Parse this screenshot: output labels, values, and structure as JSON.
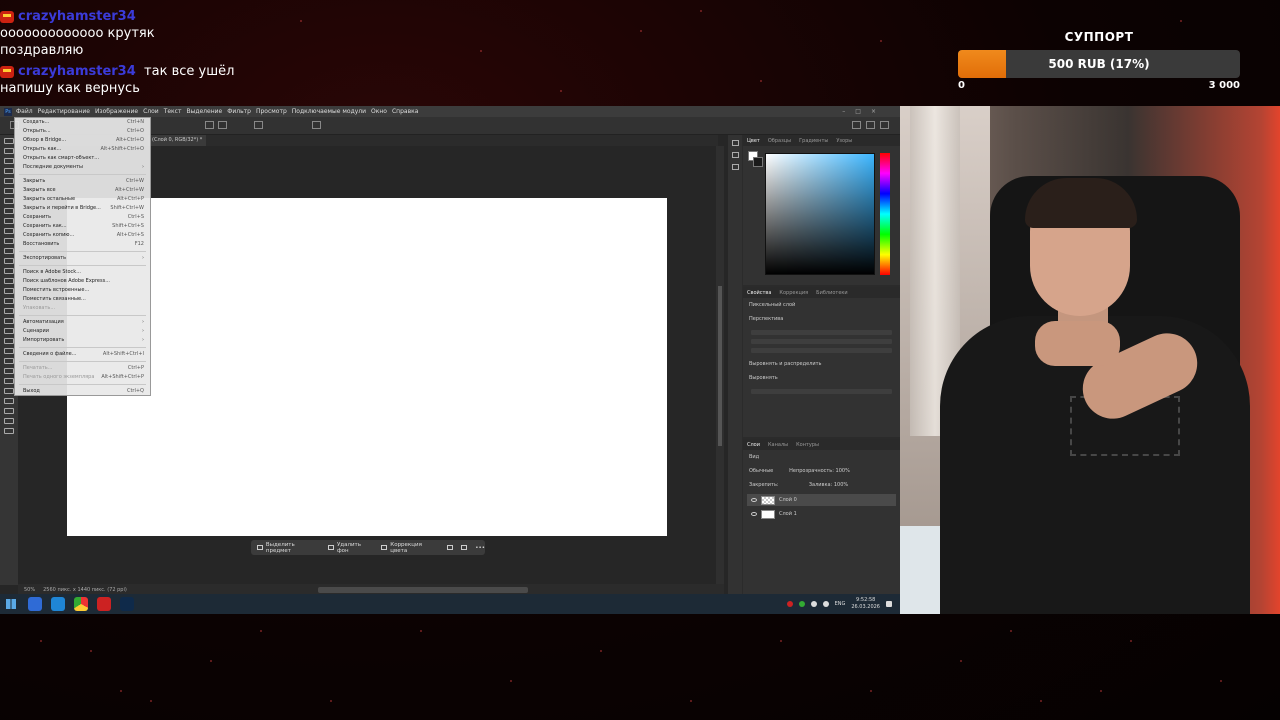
{
  "chat": {
    "messages": [
      {
        "user": "crazyhamster34",
        "text": "ооооооооооооо крутяк поздравляю"
      },
      {
        "user": "crazyhamster34",
        "text": "так все ушёл напишу как вернусь"
      }
    ]
  },
  "support": {
    "title": "СУППОРТ",
    "bar_label": "500 RUB (17%)",
    "progress_fraction": 0.17,
    "min": "0",
    "max": "3 000",
    "accent": "#f08a1c"
  },
  "photoshop": {
    "menu": [
      "Файл",
      "Редактирование",
      "Изображение",
      "Слои",
      "Текст",
      "Выделение",
      "Фильтр",
      "Просмотр",
      "Подключаемые модули",
      "Окно",
      "Справка"
    ],
    "doc_tab": "(Слой 0, RGB/32*) *",
    "file_menu": [
      {
        "label": "Создать...",
        "shortcut": "Ctrl+N"
      },
      {
        "label": "Открыть...",
        "shortcut": "Ctrl+O"
      },
      {
        "label": "Обзор в Bridge...",
        "shortcut": "Alt+Ctrl+O"
      },
      {
        "label": "Открыть как...",
        "shortcut": "Alt+Shift+Ctrl+O"
      },
      {
        "label": "Открыть как смарт-объект...",
        "shortcut": ""
      },
      {
        "label": "Последние документы",
        "shortcut": "›"
      },
      {
        "sep": true
      },
      {
        "label": "Закрыть",
        "shortcut": "Ctrl+W"
      },
      {
        "label": "Закрыть все",
        "shortcut": "Alt+Ctrl+W"
      },
      {
        "label": "Закрыть остальные",
        "shortcut": "Alt+Ctrl+P"
      },
      {
        "label": "Закрыть и перейти в Bridge...",
        "shortcut": "Shift+Ctrl+W"
      },
      {
        "label": "Сохранить",
        "shortcut": "Ctrl+S"
      },
      {
        "label": "Сохранить как...",
        "shortcut": "Shift+Ctrl+S"
      },
      {
        "label": "Сохранить копию...",
        "shortcut": "Alt+Ctrl+S"
      },
      {
        "label": "Восстановить",
        "shortcut": "F12"
      },
      {
        "sep": true
      },
      {
        "label": "Экспортировать",
        "shortcut": "›"
      },
      {
        "sep": true
      },
      {
        "label": "Поиск в Adobe Stock...",
        "shortcut": ""
      },
      {
        "label": "Поиск шаблонов Adobe Express...",
        "shortcut": ""
      },
      {
        "label": "Поместить встроенные...",
        "shortcut": ""
      },
      {
        "label": "Поместить связанные...",
        "shortcut": ""
      },
      {
        "label": "Упаковать...",
        "shortcut": "",
        "disabled": true
      },
      {
        "sep": true
      },
      {
        "label": "Автоматизация",
        "shortcut": "›"
      },
      {
        "label": "Сценарии",
        "shortcut": "›"
      },
      {
        "label": "Импортировать",
        "shortcut": "›"
      },
      {
        "sep": true
      },
      {
        "label": "Сведения о файле...",
        "shortcut": "Alt+Shift+Ctrl+I"
      },
      {
        "sep": true
      },
      {
        "label": "Печатать...",
        "shortcut": "Ctrl+P",
        "disabled": true
      },
      {
        "label": "Печать одного экземпляра",
        "shortcut": "Alt+Shift+Ctrl+P",
        "disabled": true
      },
      {
        "sep": true
      },
      {
        "label": "Выход",
        "shortcut": "Ctrl+Q"
      }
    ],
    "context_bar": [
      "Выделить предмет",
      "Удалить фон",
      "Коррекция цвета"
    ],
    "status": {
      "zoom": "50%",
      "size": "2560 пикс. x 1440 пикс. (72 ppi)"
    },
    "panels": {
      "color_tabs": [
        "Цвет",
        "Образцы",
        "Градиенты",
        "Узоры"
      ],
      "props_tabs": [
        "Свойства",
        "Коррекция",
        "Библиотеки"
      ],
      "props_layer": "Пиксельный слой",
      "props_transform": "Перспектива",
      "props_align": "Выровнять и распределить",
      "props_align_sub": "Выровнять",
      "layers_tabs": [
        "Слои",
        "Каналы",
        "Контуры"
      ],
      "layers_kind": "Вид",
      "blend_mode": "Обычные",
      "opacity_label": "Непрозрачность:",
      "opacity_value": "100%",
      "lock_label": "Закрепить:",
      "fill_label": "Заливка:",
      "fill_value": "100%",
      "layers": [
        "Слой 0",
        "Слой 1"
      ]
    }
  },
  "taskbar": {
    "lang": "ENG",
    "time": "9:52:58",
    "date": "26.03.2026"
  }
}
